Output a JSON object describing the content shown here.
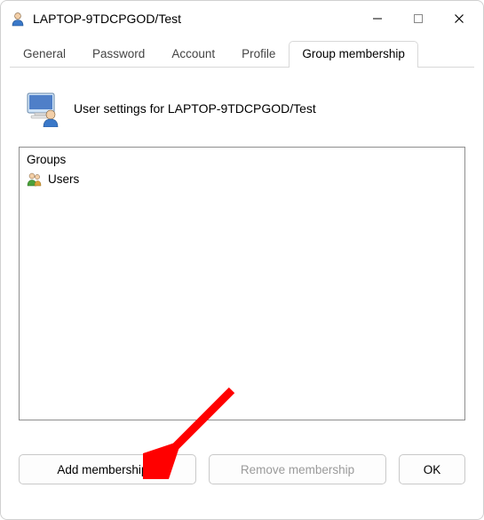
{
  "window": {
    "title": "LAPTOP-9TDCPGOD/Test"
  },
  "tabs": {
    "general": "General",
    "password": "Password",
    "account": "Account",
    "profile": "Profile",
    "group_membership": "Group membership"
  },
  "heading": "User settings for LAPTOP-9TDCPGOD/Test",
  "groups": {
    "header": "Groups",
    "items": [
      {
        "label": "Users"
      }
    ]
  },
  "buttons": {
    "add": "Add membership...",
    "remove": "Remove membership",
    "ok": "OK"
  }
}
